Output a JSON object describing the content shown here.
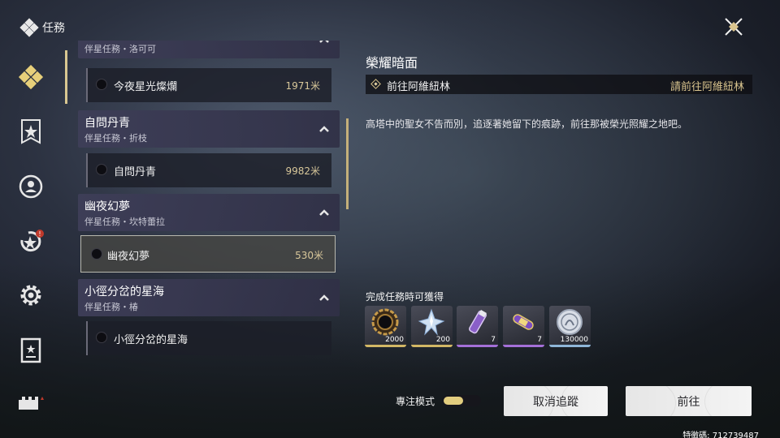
{
  "header": {
    "title": "任務"
  },
  "nav": {
    "badge_mark": "!"
  },
  "quest_list": {
    "groups": [
      {
        "title": "",
        "subtitle": "伴星任務・洛可可",
        "quest": {
          "name": "今夜星光燦爛",
          "distance": "1971米"
        }
      },
      {
        "title": "自問丹青",
        "subtitle": "伴星任務・折枝",
        "quest": {
          "name": "自問丹青",
          "distance": "9982米"
        }
      },
      {
        "title": "幽夜幻夢",
        "subtitle": "伴星任務・坎特蕾拉",
        "quest": {
          "name": "幽夜幻夢",
          "distance": "530米"
        }
      },
      {
        "title": "小徑分岔的星海",
        "subtitle": "伴星任務・椿",
        "quest": {
          "name": "小徑分岔的星海",
          "distance": ""
        }
      }
    ]
  },
  "detail": {
    "title": "榮耀暗面",
    "objective": "前往阿維紐林",
    "objective_status": "請前往阿維紐林",
    "description": "高塔中的聖女不告而別，追逐著她留下的痕跡，前往那被榮光照耀之地吧。",
    "rewards_label": "完成任務時可獲得",
    "rewards": [
      {
        "icon": "dark-ring-icon",
        "qty": "2000",
        "rarity_color": "#d2b765"
      },
      {
        "icon": "star-crystal-icon",
        "qty": "200",
        "rarity_color": "#d2b765"
      },
      {
        "icon": "purple-vial-icon",
        "qty": "7",
        "rarity_color": "#a470d8"
      },
      {
        "icon": "capsule-icon",
        "qty": "7",
        "rarity_color": "#a470d8"
      },
      {
        "icon": "silver-coin-icon",
        "qty": "130000",
        "rarity_color": "#8fb6d8"
      }
    ]
  },
  "footer": {
    "focus_mode_label": "專注模式",
    "focus_mode_on": true,
    "cancel_track_label": "取消追蹤",
    "go_label": "前往",
    "uid": "特徵碼: 712739487"
  },
  "colors": {
    "accent_gold": "#d9c48e",
    "panel": "#2e2e44"
  }
}
